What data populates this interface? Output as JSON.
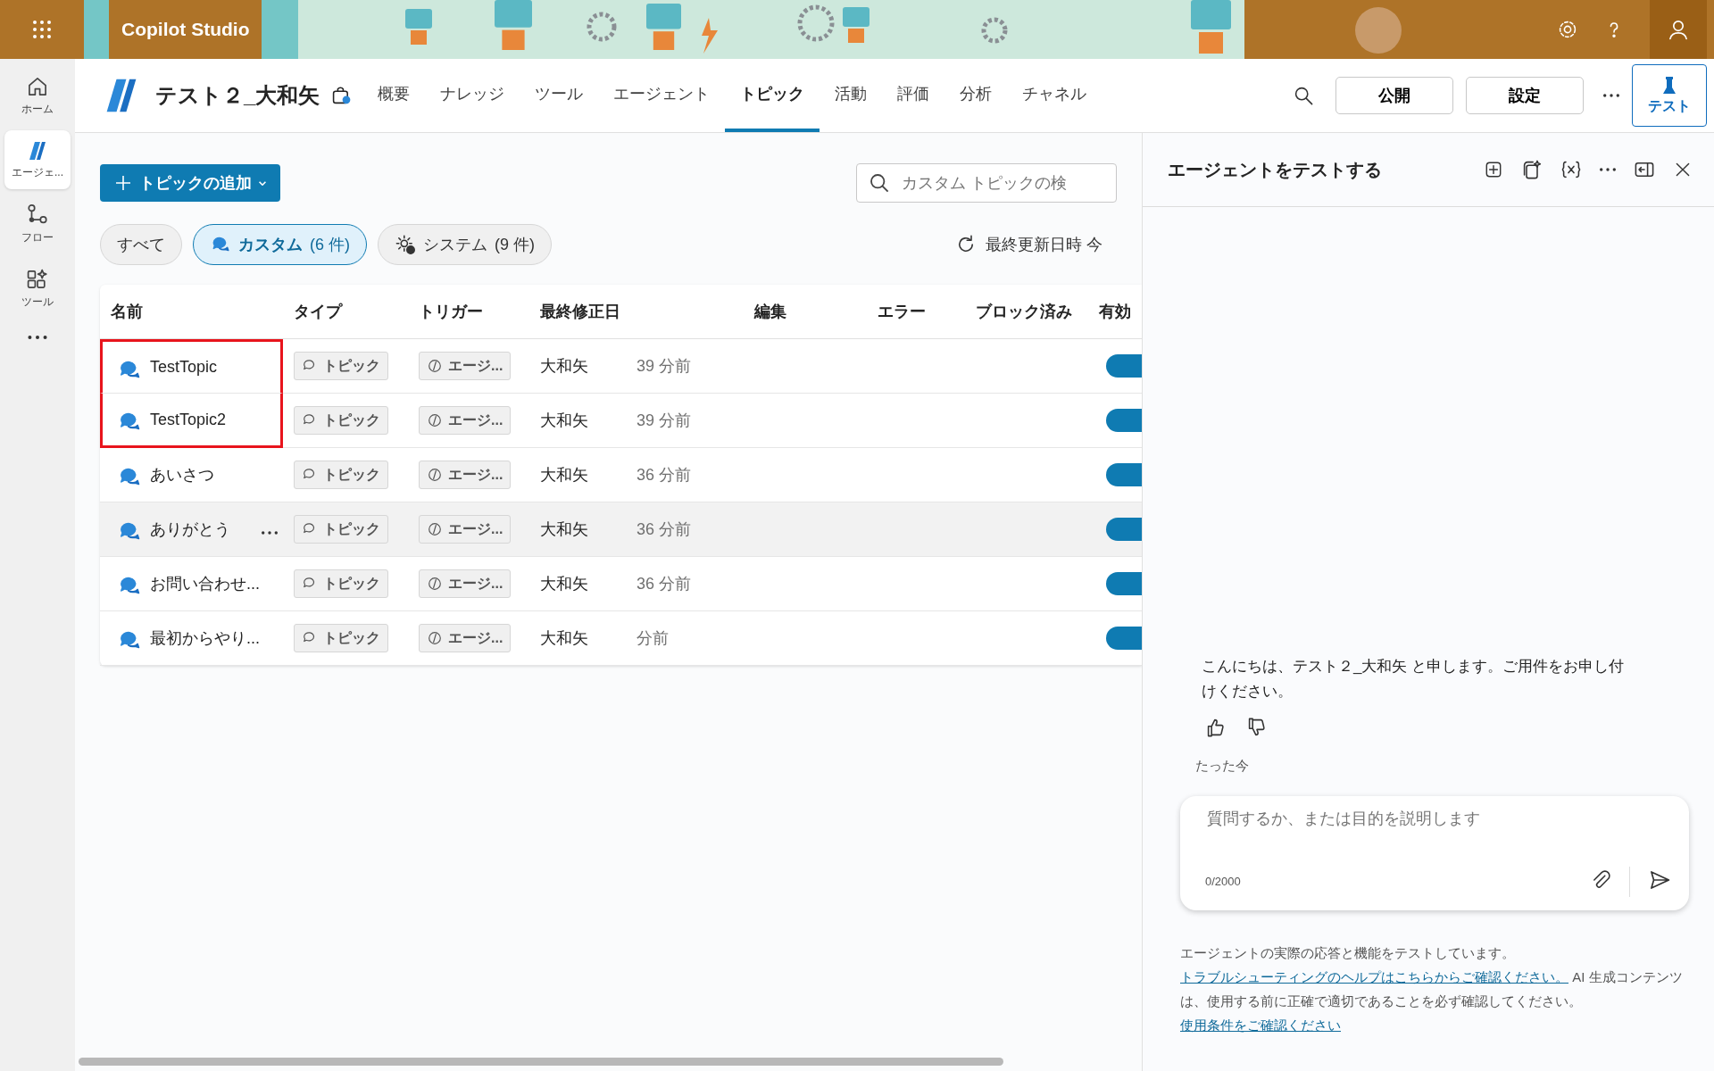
{
  "app": {
    "name": "Copilot Studio"
  },
  "sidebar": {
    "items": [
      {
        "label": "ホーム",
        "selected": false
      },
      {
        "label": "エージェ...",
        "selected": true
      },
      {
        "label": "フロー",
        "selected": false
      },
      {
        "label": "ツール",
        "selected": false
      }
    ]
  },
  "agent": {
    "name": "テスト２_大和矢"
  },
  "tabs": [
    {
      "label": "概要",
      "selected": false
    },
    {
      "label": "ナレッジ",
      "selected": false
    },
    {
      "label": "ツール",
      "selected": false
    },
    {
      "label": "エージェント",
      "selected": false
    },
    {
      "label": "トピック",
      "selected": true
    },
    {
      "label": "活動",
      "selected": false
    },
    {
      "label": "評価",
      "selected": false
    },
    {
      "label": "分析",
      "selected": false
    },
    {
      "label": "チャネル",
      "selected": false
    }
  ],
  "actions": {
    "publish": "公開",
    "settings": "設定",
    "test": "テスト"
  },
  "toolbar": {
    "add_button": "トピックの追加",
    "search": {
      "placeholder": "カスタム トピックの検"
    },
    "refresh": "最終更新日時 今"
  },
  "filters": [
    {
      "label": "すべて",
      "selected": false
    },
    {
      "label": "カスタム",
      "count": "(6 件)",
      "selected": true
    },
    {
      "label": "システム",
      "count": "(9 件)",
      "selected": false
    }
  ],
  "table": {
    "columns": [
      "名前",
      "タイプ",
      "トリガー",
      "最終修正日",
      "編集",
      "エラー",
      "ブロック済み",
      "有効"
    ],
    "rows": [
      {
        "name": "TestTopic",
        "type": "トピック",
        "trigger": "エージ...",
        "modified_by": "大和矢",
        "modified": "39 分前",
        "enabled": true,
        "highlighted": false,
        "outlined": true
      },
      {
        "name": "TestTopic2",
        "type": "トピック",
        "trigger": "エージ...",
        "modified_by": "大和矢",
        "modified": "39 分前",
        "enabled": true,
        "highlighted": false,
        "outlined": true
      },
      {
        "name": "あいさつ",
        "type": "トピック",
        "trigger": "エージ...",
        "modified_by": "大和矢",
        "modified": "36 分前",
        "enabled": true,
        "highlighted": false,
        "outlined": false
      },
      {
        "name": "ありがとう",
        "type": "トピック",
        "trigger": "エージ...",
        "modified_by": "大和矢",
        "modified": "36 分前",
        "enabled": true,
        "highlighted": true,
        "outlined": false
      },
      {
        "name": "お問い合わせ...",
        "type": "トピック",
        "trigger": "エージ...",
        "modified_by": "大和矢",
        "modified": "36 分前",
        "enabled": true,
        "highlighted": false,
        "outlined": false
      },
      {
        "name": "最初からやり...",
        "type": "トピック",
        "trigger": "エージ...",
        "modified_by": "大和矢",
        "modified": "分前",
        "enabled": true,
        "highlighted": false,
        "outlined": false
      }
    ]
  },
  "test_panel": {
    "title": "エージェントをテストする",
    "message": "こんにちは、テスト２_大和矢 と申します。ご用件をお申し付けください。",
    "timestamp": "たった今",
    "input": {
      "placeholder": "質問するか、または目的を説明します",
      "counter": "0/2000"
    },
    "disclaimer": [
      {
        "kind": "text",
        "text": "エージェントの実際の応答と機能をテストしています。"
      },
      {
        "kind": "link",
        "text": "トラブルシューティングのヘルプはこちらからご確認ください。"
      },
      {
        "kind": "text",
        "text": "AI 生成コンテンツは、使用する前に正確で適切であることを必ず確認してください。"
      },
      {
        "kind": "link",
        "text": "使用条件をご確認ください"
      }
    ]
  }
}
